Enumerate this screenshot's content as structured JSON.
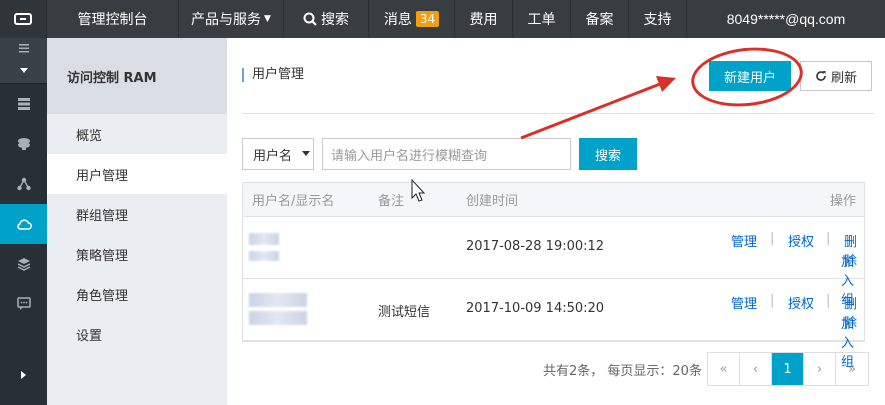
{
  "topbar": {
    "console": "管理控制台",
    "products": "产品与服务",
    "search": "搜索",
    "messages": "消息",
    "message_count": "34",
    "fees": "费用",
    "tickets": "工单",
    "beian": "备案",
    "support": "支持",
    "user": "8049*****@qq.com"
  },
  "subside": {
    "title": "访问控制 RAM",
    "items": [
      "概览",
      "用户管理",
      "群组管理",
      "策略管理",
      "角色管理",
      "设置"
    ]
  },
  "page": {
    "title": "用户管理",
    "new_user": "新建用户",
    "refresh": "刷新"
  },
  "filter": {
    "select_value": "用户名",
    "placeholder": "请输入用户名进行模糊查询",
    "search_button": "搜索"
  },
  "table": {
    "headers": [
      "用户名/显示名",
      "备注",
      "创建时间",
      "操作"
    ],
    "rows": [
      {
        "note": "",
        "created": "2017-08-28 19:00:12",
        "ops": [
          "管理",
          "授权",
          "删除",
          "加入组"
        ]
      },
      {
        "note": "测试短信",
        "created": "2017-10-09 14:50:20",
        "ops": [
          "管理",
          "授权",
          "删除",
          "加入组"
        ]
      }
    ],
    "separator": "|"
  },
  "pager": {
    "summary": "共有2条， 每页显示：20条",
    "first": "«",
    "prev": "‹",
    "current": "1",
    "next": "›",
    "last": "»"
  },
  "colors": {
    "accent": "#00a2ca",
    "annotation": "#d9302a",
    "badge": "#f39d12"
  }
}
